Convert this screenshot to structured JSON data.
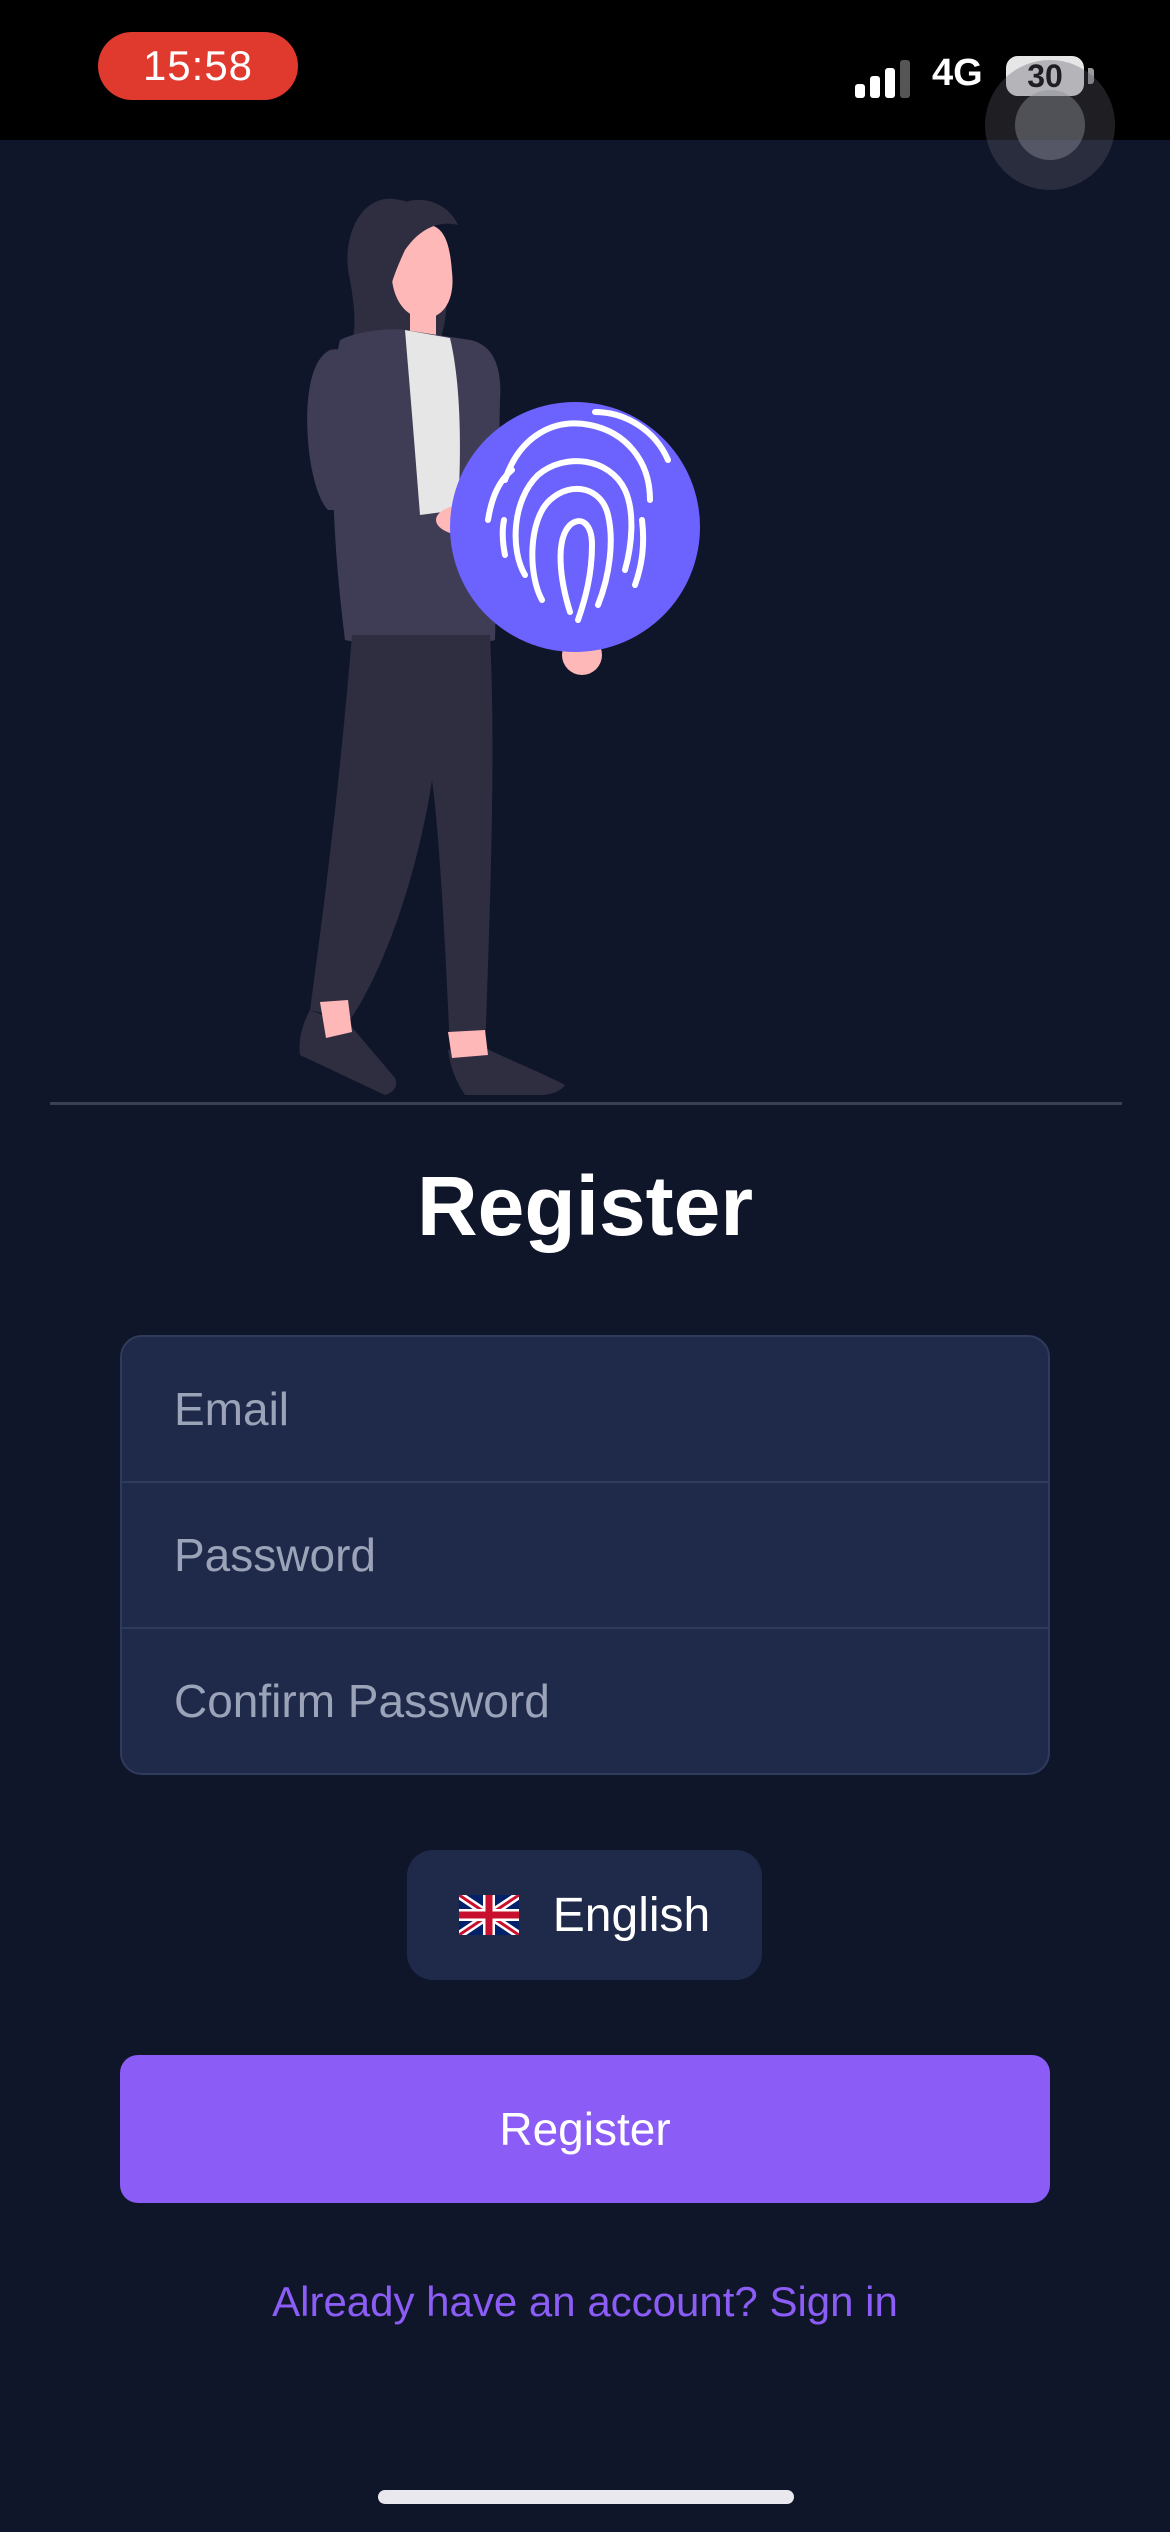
{
  "status_bar": {
    "time": "15:58",
    "network": "4G",
    "battery": "30"
  },
  "page": {
    "title": "Register"
  },
  "form": {
    "email_placeholder": "Email",
    "password_placeholder": "Password",
    "confirm_password_placeholder": "Confirm Password"
  },
  "language": {
    "label": "English",
    "flag_icon": "uk-flag-icon"
  },
  "actions": {
    "register_label": "Register",
    "signin_link": "Already have an account? Sign in"
  },
  "colors": {
    "background": "#10162a",
    "field": "#1f2a4a",
    "accent": "#8b5cf6",
    "fingerprint_circle": "#6c63ff"
  }
}
